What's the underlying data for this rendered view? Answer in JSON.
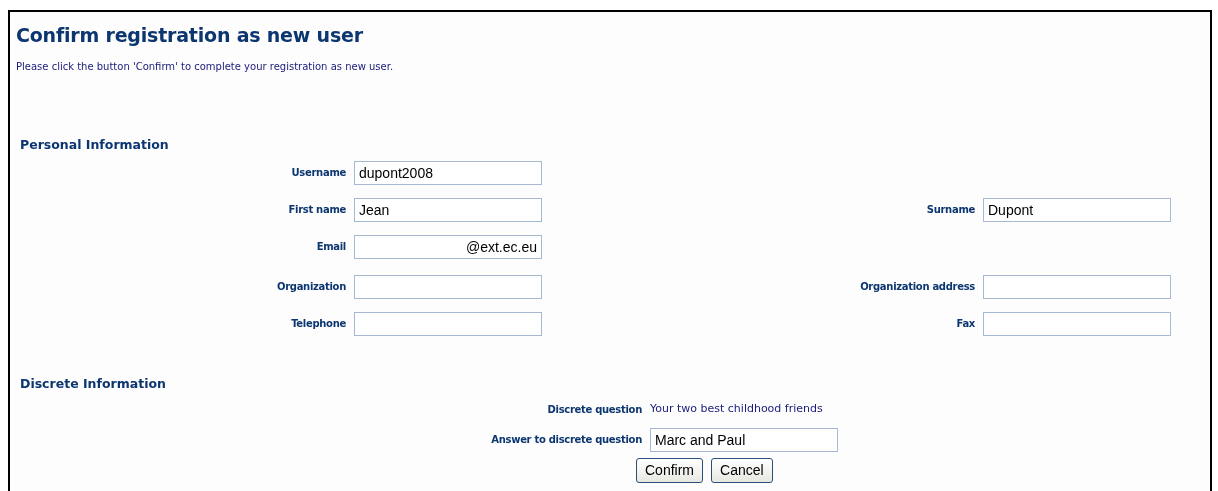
{
  "title": "Confirm registration as new user",
  "instruction": "Please click the button 'Confirm' to complete your registration as new user.",
  "personal": {
    "heading": "Personal Information",
    "rows": [
      {
        "left": {
          "label": "Username",
          "value": "dupont2008"
        }
      },
      {
        "left": {
          "label": "First name",
          "value": "Jean"
        },
        "right": {
          "label": "Surname",
          "value": "Dupont"
        }
      },
      {
        "left": {
          "label": "Email",
          "value": "@ext.ec.eu",
          "kind": "suffix"
        }
      },
      {
        "left": {
          "label": "Organization"
        },
        "right": {
          "label": "Organization address"
        }
      },
      {
        "left": {
          "label": "Telephone"
        },
        "right": {
          "label": "Fax"
        }
      }
    ]
  },
  "discrete": {
    "heading": "Discrete Information",
    "question": {
      "label": "Discrete question",
      "value": "Your two best childhood friends"
    },
    "answer": {
      "label": "Answer to discrete question",
      "value": "Marc and Paul"
    }
  },
  "buttons": [
    "Confirm",
    "Cancel"
  ]
}
